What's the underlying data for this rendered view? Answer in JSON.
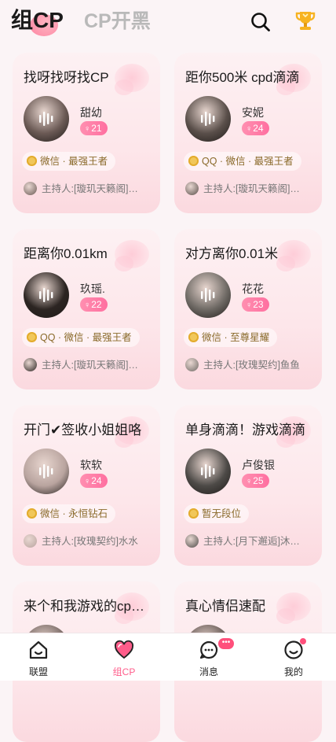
{
  "header": {
    "active_tab": "组CP",
    "inactive_tab": "CP开黑"
  },
  "cards": [
    {
      "title": "找呀找呀找CP",
      "name": "甜幼",
      "gender": "♀",
      "count": "21",
      "tags": "微信 · 最强王者",
      "host": "主持人:[璇玑天籁阁]…",
      "avatar_color": "#6b5a55"
    },
    {
      "title": "距你500米 cpd滴滴",
      "name": "安妮",
      "gender": "♀",
      "count": "24",
      "tags": "QQ · 微信 · 最强王者",
      "host": "主持人:[璇玑天籁阁]…",
      "avatar_color": "#5a4f4a"
    },
    {
      "title": "距离你0.01km",
      "name": "玖瑶.",
      "gender": "♀",
      "count": "22",
      "tags": "QQ · 微信 · 最强王者",
      "host": "主持人:[璇玑天籁阁]…",
      "avatar_color": "#2c2522"
    },
    {
      "title": "对方离你0.01米",
      "name": "花花",
      "gender": "♀",
      "count": "23",
      "tags": "微信 · 至尊星耀",
      "host": "主持人:[玫瑰契约]鱼鱼",
      "avatar_color": "#6f6a65"
    },
    {
      "title": "开门✔签收小姐姐咯",
      "name": "软软",
      "gender": "♀",
      "count": "24",
      "tags": "微信 · 永恒钻石",
      "host": "主持人:[玫瑰契约]水水",
      "avatar_color": "#b9a49f"
    },
    {
      "title": "单身滴滴！游戏滴滴",
      "name": "卢俊银",
      "gender": "♀",
      "count": "25",
      "tags": "暂无段位",
      "host": "主持人:[月下邂逅]沐…",
      "avatar_color": "#4d4a47"
    },
    {
      "title": "来个和我游戏的cp搭子",
      "name": "",
      "gender": "",
      "count": "",
      "tags": "",
      "host": "",
      "avatar_color": "#7a6a66"
    },
    {
      "title": "真心情侣速配",
      "name": "",
      "gender": "",
      "count": "",
      "tags": "",
      "host": "",
      "avatar_color": "#6a5c58"
    }
  ],
  "nav": [
    {
      "label": "联盟",
      "icon": "home-icon",
      "active": false
    },
    {
      "label": "组CP",
      "icon": "heart-icon",
      "active": true
    },
    {
      "label": "消息",
      "icon": "message-icon",
      "active": false,
      "badge": "•••"
    },
    {
      "label": "我的",
      "icon": "profile-icon",
      "active": false
    }
  ],
  "colors": {
    "accent": "#ff5c8a",
    "card_bg": "#fde6ea"
  }
}
